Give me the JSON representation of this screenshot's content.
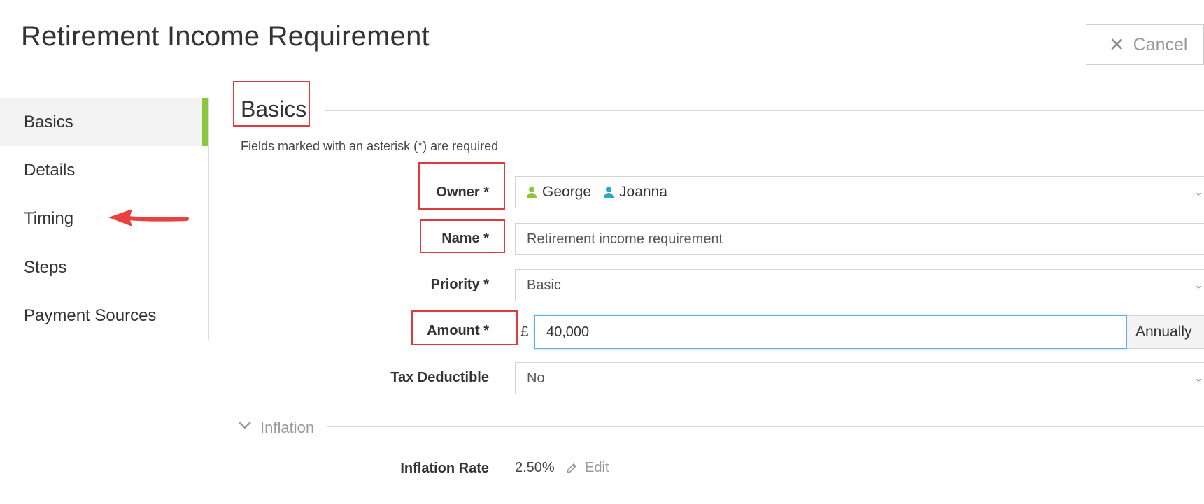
{
  "page": {
    "title": "Retirement Income Requirement"
  },
  "header": {
    "cancel_label": "Cancel"
  },
  "sidebar": {
    "items": [
      {
        "label": "Basics"
      },
      {
        "label": "Details"
      },
      {
        "label": "Timing"
      },
      {
        "label": "Steps"
      },
      {
        "label": "Payment Sources"
      }
    ]
  },
  "section": {
    "title": "Basics",
    "required_note": "Fields marked with an asterisk (*) are required"
  },
  "form": {
    "owner": {
      "label": "Owner *",
      "owners": [
        {
          "name": "George",
          "color": "#8cc63f"
        },
        {
          "name": "Joanna",
          "color": "#29a8c9"
        }
      ]
    },
    "name": {
      "label": "Name *",
      "value": "Retirement income requirement"
    },
    "priority": {
      "label": "Priority *",
      "value": "Basic"
    },
    "amount": {
      "label": "Amount *",
      "currency": "£",
      "value": "40,000",
      "frequency": "Annually"
    },
    "tax_deductible": {
      "label": "Tax Deductible",
      "value": "No"
    }
  },
  "inflation": {
    "title": "Inflation",
    "rate_label": "Inflation Rate",
    "rate_value": "2.50%",
    "edit_label": "Edit"
  },
  "colors": {
    "accent": "#8cc63f",
    "annotation": "#e0393e",
    "focus": "#66afe9"
  }
}
